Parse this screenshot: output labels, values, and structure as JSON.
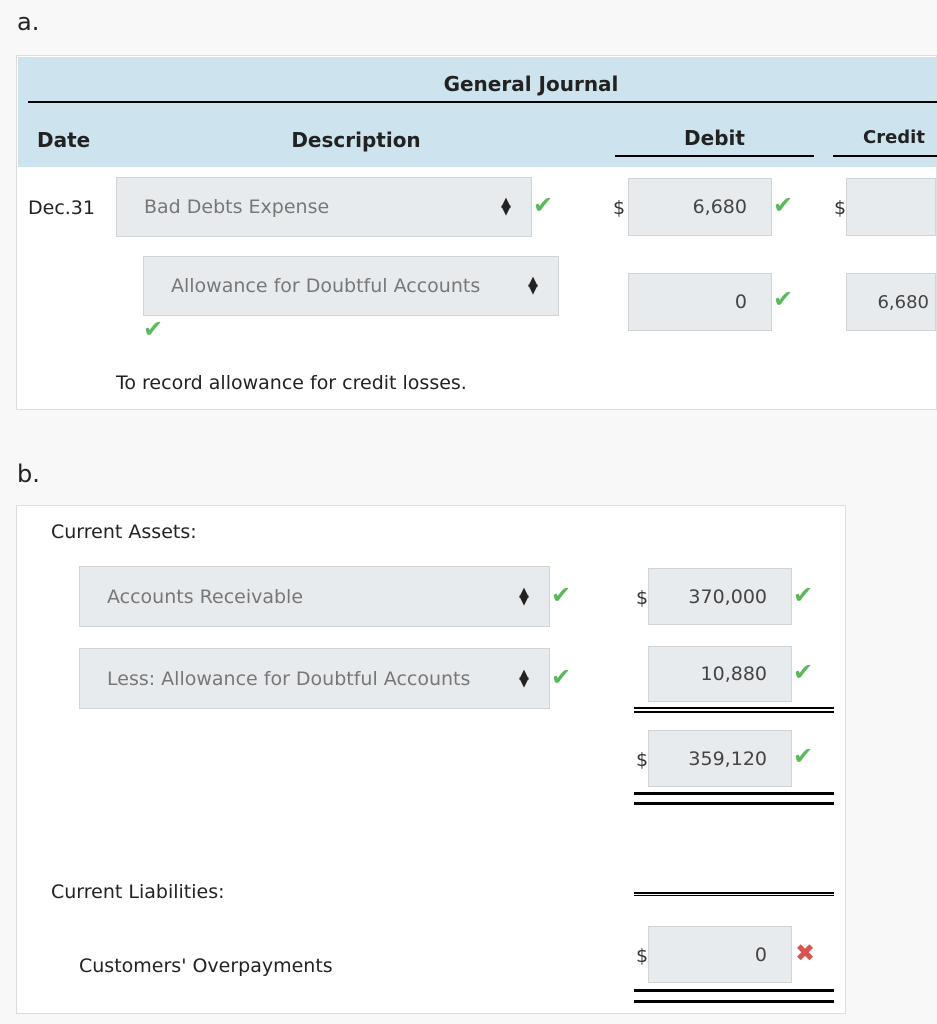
{
  "part_a": {
    "label": "a.",
    "title": "General Journal",
    "headers": {
      "date": "Date",
      "description": "Description",
      "debit": "Debit",
      "credit": "Credit"
    },
    "rows": [
      {
        "date": "Dec.31",
        "account": "Bad Debts Expense",
        "debit": "6,680",
        "credit": "",
        "debit_status": "correct",
        "account_status": "correct"
      },
      {
        "account": "Allowance for Doubtful Accounts",
        "debit": "0",
        "credit": "6,680",
        "debit_status": "correct",
        "account_status": "correct"
      }
    ],
    "note": "To record allowance for credit losses."
  },
  "part_b": {
    "label": "b.",
    "current_assets_label": "Current Assets:",
    "ar_account": "Accounts Receivable",
    "ar_value": "370,000",
    "allow_account": "Less: Allowance for Doubtful Accounts",
    "allow_value": "10,880",
    "net_value": "359,120",
    "current_liabilities_label": "Current Liabilities:",
    "overpay_label": "Customers' Overpayments",
    "overpay_value": "0",
    "overpay_status": "incorrect"
  },
  "currency": "$",
  "icons": {
    "correct": "✔",
    "incorrect": "✖",
    "select": "▲▼"
  },
  "colors": {
    "header": "#cde3ed",
    "correct": "#5cb85c",
    "incorrect": "#d9534f"
  }
}
